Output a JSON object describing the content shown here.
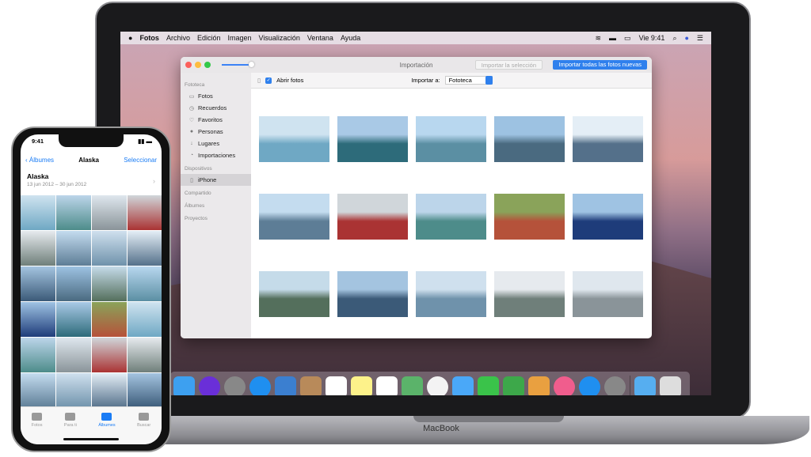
{
  "menubar": {
    "apple": "",
    "app": "Fotos",
    "items": [
      "Archivo",
      "Edición",
      "Imagen",
      "Visualización",
      "Ventana",
      "Ayuda"
    ],
    "clock": "Vie 9:41",
    "wifi": "wifi-icon",
    "search": "⌕"
  },
  "window": {
    "title": "Importación",
    "import_selection": "Importar la selección",
    "import_all": "Importar todas las fotos nuevas",
    "open_photos": "Abrir fotos",
    "import_to_label": "Importar a:",
    "import_to_value": "Fototeca"
  },
  "sidebar": {
    "sections": [
      {
        "title": "Fototeca",
        "items": [
          {
            "label": "Fotos",
            "icon": "▭"
          },
          {
            "label": "Recuerdos",
            "icon": "◷"
          },
          {
            "label": "Favoritos",
            "icon": "♡"
          },
          {
            "label": "Personas",
            "icon": "●"
          },
          {
            "label": "Lugares",
            "icon": "↓"
          },
          {
            "label": "Importaciones",
            "icon": "◔"
          }
        ]
      },
      {
        "title": "Dispositivos",
        "items": [
          {
            "label": "iPhone",
            "icon": "▯",
            "selected": true
          }
        ]
      },
      {
        "title": "Compartido",
        "items": []
      },
      {
        "title": "Álbumes",
        "items": []
      },
      {
        "title": "Proyectos",
        "items": []
      }
    ]
  },
  "dock": [
    "finder",
    "siri",
    "launchpad",
    "safari",
    "mail",
    "contacts",
    "calendar",
    "notes",
    "reminders",
    "maps",
    "photos",
    "messages",
    "facetime",
    "numbers",
    "keynote",
    "itunes",
    "app-store",
    "system-preferences",
    "downloads-folder",
    "trash"
  ],
  "macbook_label": "MacBook",
  "iphone": {
    "time": "9:41",
    "back": "Álbumes",
    "title": "Alaska",
    "select": "Seleccionar",
    "album_title": "Alaska",
    "album_dates": "13 jun 2012 – 30 jun 2012",
    "tabs": [
      {
        "label": "Fotos"
      },
      {
        "label": "Para ti"
      },
      {
        "label": "Álbumes",
        "active": true
      },
      {
        "label": "Buscar"
      }
    ]
  }
}
